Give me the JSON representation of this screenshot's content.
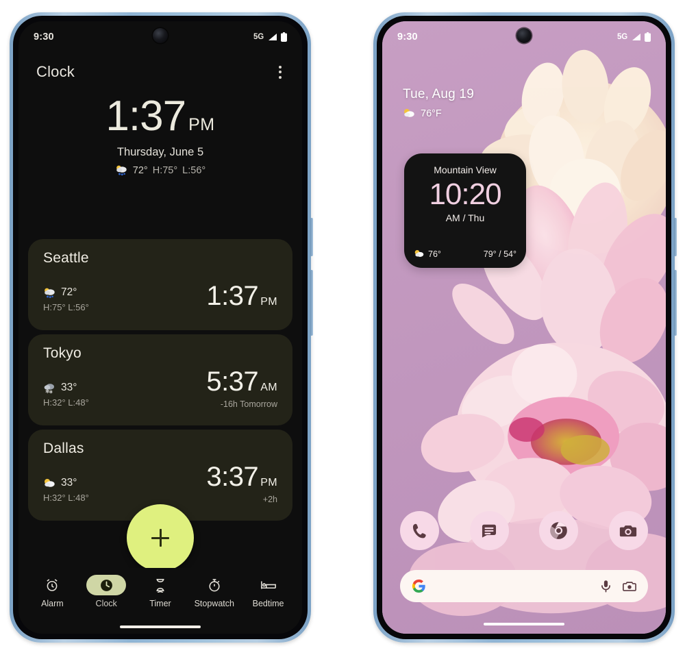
{
  "phones": {
    "left": {
      "status_bar": {
        "time": "9:30",
        "network": "5G",
        "signal_icon": "signal-bars-icon",
        "battery_icon": "battery-icon"
      },
      "app": {
        "title": "Clock",
        "overflow_icon": "more-vert-icon",
        "hero": {
          "time": "1:37",
          "ampm": "PM",
          "date": "Thursday, June 5",
          "weather_icon": "sun-behind-rain-cloud-icon",
          "temp": "72°",
          "high": "H:75°",
          "low": "L:56°"
        },
        "cities": [
          {
            "name": "Seattle",
            "weather_icon": "sun-behind-rain-cloud-icon",
            "temp": "72°",
            "highlow": "H:75° L:56°",
            "time": "1:37",
            "ampm": "PM",
            "offset": ""
          },
          {
            "name": "Tokyo",
            "weather_icon": "snow-cloud-icon",
            "temp": "33°",
            "highlow": "H:32° L:48°",
            "time": "5:37",
            "ampm": "AM",
            "offset": "-16h  Tomorrow"
          },
          {
            "name": "Dallas",
            "weather_icon": "sun-behind-cloud-icon",
            "temp": "33°",
            "highlow": "H:32° L:48°",
            "time": "3:37",
            "ampm": "PM",
            "offset": "+2h"
          }
        ],
        "fab": {
          "icon": "plus-icon",
          "label": "Add city"
        },
        "nav": [
          {
            "label": "Alarm",
            "icon": "alarm-clock-icon",
            "active": false
          },
          {
            "label": "Clock",
            "icon": "clock-icon",
            "active": true
          },
          {
            "label": "Timer",
            "icon": "hourglass-icon",
            "active": false
          },
          {
            "label": "Stopwatch",
            "icon": "stopwatch-icon",
            "active": false
          },
          {
            "label": "Bedtime",
            "icon": "bed-icon",
            "active": false
          }
        ]
      }
    },
    "right": {
      "status_bar": {
        "time": "9:30",
        "network": "5G",
        "signal_icon": "signal-bars-icon",
        "battery_icon": "battery-icon"
      },
      "home": {
        "date": "Tue, Aug 19",
        "weather_icon": "sun-behind-cloud-icon",
        "temp": "76°F",
        "widget": {
          "city": "Mountain View",
          "time": "10:20",
          "sub": "AM / Thu",
          "weather_icon": "sun-behind-cloud-icon",
          "now_temp": "76°",
          "highlow": "79° / 54°"
        },
        "dock": [
          {
            "name": "Phone",
            "icon": "phone-icon"
          },
          {
            "name": "Messages",
            "icon": "messages-icon"
          },
          {
            "name": "Chrome",
            "icon": "chrome-icon"
          },
          {
            "name": "Camera",
            "icon": "camera-icon"
          }
        ],
        "search": {
          "logo": "google-g-icon",
          "placeholder": "",
          "value": "",
          "mic_icon": "microphone-icon",
          "lens_icon": "google-lens-icon"
        }
      }
    }
  },
  "colors": {
    "clock_bg": "#0e0e0e",
    "card_bg": "#232318",
    "fab": "#dff07f",
    "nav_pill": "#cfd6a5",
    "wallpaper": "#c39abf",
    "widget_bg": "#131313",
    "widget_time": "#f0cfe1",
    "dock_icon_bg": "#f7d9e7",
    "search_bg": "#fdf6f2",
    "frame": "#8fb4d4"
  }
}
